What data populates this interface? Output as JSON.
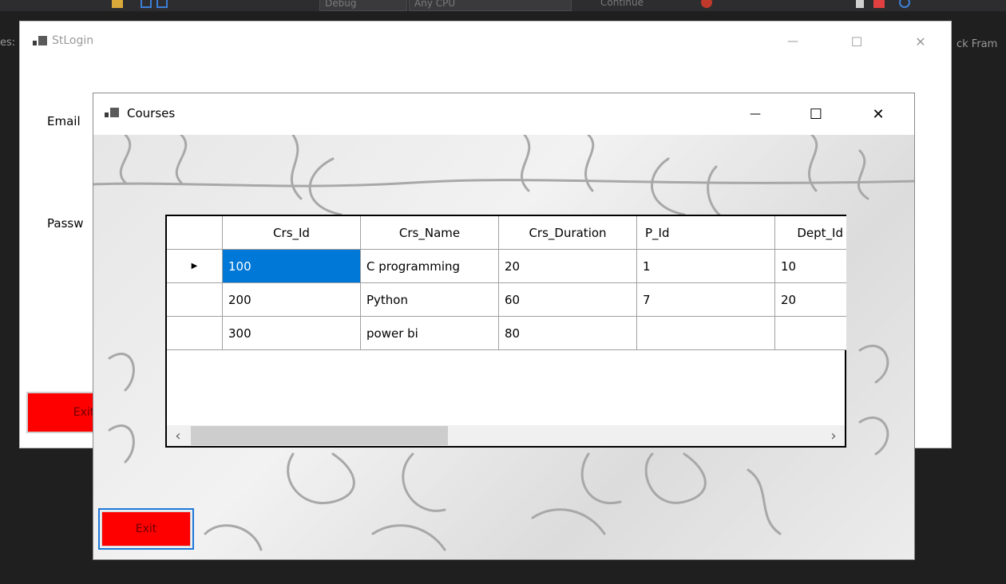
{
  "ide": {
    "config_dropdown": "Debug",
    "platform_dropdown": "Any CPU",
    "continue_label": "Continue",
    "left_edge_text": "es:",
    "right_edge_text": "ck Fram"
  },
  "stlogin": {
    "title": "StLogin",
    "email_label": "Email",
    "password_label": "Passw",
    "exit_label": "Exit",
    "minimize": "—",
    "maximize": "☐",
    "close": "✕"
  },
  "courses": {
    "title": "Courses",
    "minimize": "—",
    "maximize": "☐",
    "close": "✕",
    "exit_label": "Exit",
    "grid": {
      "columns": [
        "Crs_Id",
        "Crs_Name",
        "Crs_Duration",
        "P_Id",
        "Dept_Id"
      ],
      "current_row_marker": "▶",
      "rows": [
        [
          "100",
          "C programming",
          "20",
          "1",
          "10"
        ],
        [
          "200",
          "Python",
          "60",
          "7",
          "20"
        ],
        [
          "300",
          "power bi",
          "80",
          "",
          ""
        ]
      ],
      "scroll_left": "‹",
      "scroll_right": "›"
    }
  },
  "colors": {
    "exit_button": "#ff0000",
    "selection": "#0078d7",
    "focus_border": "#1e78d7"
  }
}
